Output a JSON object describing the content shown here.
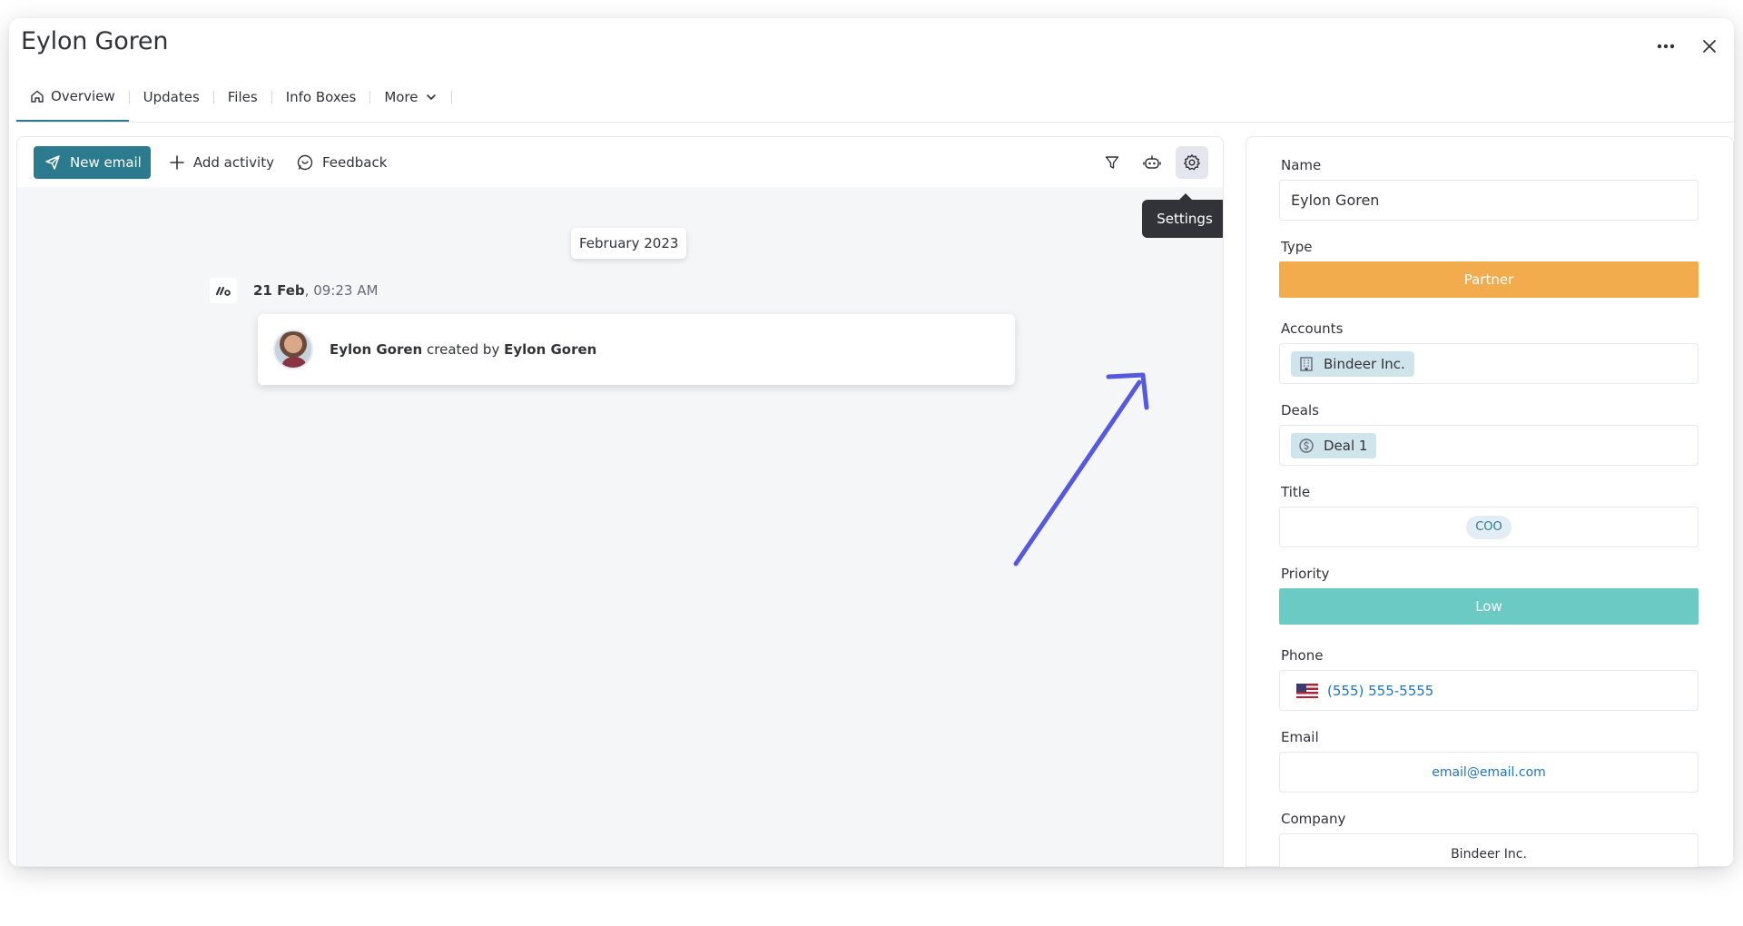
{
  "window": {
    "title": "Eylon Goren"
  },
  "tabs": [
    {
      "label": "Overview",
      "icon": "home-icon"
    },
    {
      "label": "Updates"
    },
    {
      "label": "Files"
    },
    {
      "label": "Info Boxes"
    },
    {
      "label": "More",
      "icon": "chevron-down-icon"
    }
  ],
  "toolbar": {
    "new_email": "New email",
    "add_activity": "Add activity",
    "feedback": "Feedback",
    "tooltip": "Settings"
  },
  "timeline": {
    "month": "February 2023",
    "entry_date": "21 Feb",
    "entry_time": ", 09:23 AM",
    "entry_subject": "Eylon Goren",
    "entry_verb": " created by ",
    "entry_actor": "Eylon Goren"
  },
  "fields": {
    "name_label": "Name",
    "name_value": "Eylon Goren",
    "type_label": "Type",
    "type_value": "Partner",
    "accounts_label": "Accounts",
    "accounts_value": "Bindeer Inc.",
    "deals_label": "Deals",
    "deals_value": "Deal 1",
    "title_label": "Title",
    "title_value": "COO",
    "priority_label": "Priority",
    "priority_value": "Low",
    "phone_label": "Phone",
    "phone_value": "(555) 555-5555",
    "email_label": "Email",
    "email_value": "email@email.com",
    "company_label": "Company",
    "company_value": "Bindeer Inc."
  },
  "colors": {
    "accent": "#2c7a8e",
    "partner": "#f2ac4e",
    "low": "#6ccac4",
    "arrow": "#5559df"
  }
}
